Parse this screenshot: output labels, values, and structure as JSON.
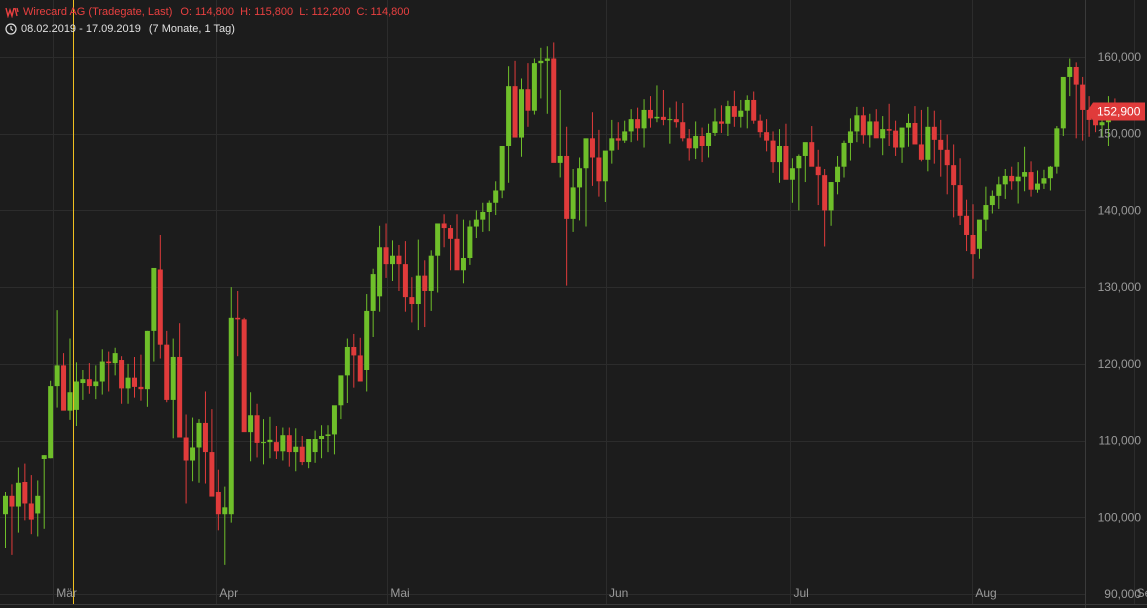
{
  "header": {
    "instrument": "Wirecard AG (Tradegate, Last)",
    "ohlc": "O: 114,800  H: 115,800  L: 112,200  C: 114,800",
    "period": "08.02.2019 - 17.09.2019",
    "range": "(7 Monate, 1 Tag)",
    "logo_icon": "instrument-logo-icon",
    "clock_icon": "clock-icon"
  },
  "last_price": "152,900",
  "colors": {
    "background": "#1c1c1c",
    "grid": "#2c2c2c",
    "up": "#6fbf2a",
    "down": "#e03b3b",
    "cursor": "#f0c020",
    "price_tag": "#e03b3b",
    "axis_text": "#9a9a9a"
  },
  "chart_data": {
    "type": "candlestick",
    "title": "Wirecard AG (Tradegate, Last)",
    "x_labels": [
      "Mär",
      "Apr",
      "Mai",
      "Jun",
      "Jul",
      "Aug",
      "Sep"
    ],
    "x_label_positions": [
      7.4,
      32.7,
      59.2,
      93.1,
      121.7,
      149.9,
      174.9
    ],
    "y_ticks": [
      90000,
      100000,
      110000,
      120000,
      130000,
      140000,
      150000,
      160000
    ],
    "y_tick_labels": [
      "90,000",
      "100,000",
      "110,000",
      "120,000",
      "130,000",
      "140,000",
      "150,000",
      "160,000"
    ],
    "ylim": [
      90000,
      167000
    ],
    "grid": true,
    "crosshair_index": 10.5,
    "candles": [
      [
        100400,
        103300,
        96000,
        102800
      ],
      [
        102800,
        104300,
        95100,
        101400
      ],
      [
        101400,
        106500,
        98000,
        104500
      ],
      [
        104600,
        107000,
        99600,
        101800
      ],
      [
        101800,
        105500,
        97800,
        99700
      ],
      [
        100500,
        104800,
        97500,
        102800
      ],
      [
        107600,
        108100,
        98500,
        108100
      ],
      [
        107700,
        117800,
        107700,
        117100
      ],
      [
        117100,
        127000,
        114300,
        119800
      ],
      [
        119800,
        121400,
        115100,
        113900
      ],
      [
        113900,
        123300,
        112700,
        116300
      ],
      [
        114000,
        120200,
        111900,
        117700
      ],
      [
        117500,
        119200,
        115300,
        118000
      ],
      [
        118000,
        120100,
        116100,
        117100
      ],
      [
        117100,
        119800,
        115400,
        117700
      ],
      [
        117700,
        121900,
        116000,
        120300
      ],
      [
        120300,
        121600,
        116400,
        120100
      ],
      [
        120100,
        122100,
        118500,
        121400
      ],
      [
        120500,
        121000,
        114800,
        116800
      ],
      [
        116800,
        120000,
        114800,
        118200
      ],
      [
        118200,
        120900,
        115600,
        117000
      ],
      [
        117000,
        121200,
        115200,
        116700
      ],
      [
        116700,
        124300,
        114400,
        124300
      ],
      [
        124300,
        131600,
        120300,
        132500
      ],
      [
        132300,
        136800,
        120700,
        122500
      ],
      [
        122500,
        124300,
        115000,
        115300
      ],
      [
        115300,
        123300,
        110300,
        120900
      ],
      [
        120900,
        125300,
        112300,
        110400
      ],
      [
        110400,
        113400,
        101800,
        107400
      ],
      [
        107400,
        113000,
        104700,
        109100
      ],
      [
        109100,
        112800,
        104500,
        112300
      ],
      [
        112300,
        116400,
        104400,
        108500
      ],
      [
        108500,
        114100,
        103100,
        102700
      ],
      [
        103300,
        106200,
        98300,
        100400
      ],
      [
        100400,
        104000,
        93800,
        101300
      ],
      [
        100400,
        130000,
        99300,
        126000
      ],
      [
        126000,
        129500,
        121000,
        125800
      ],
      [
        125800,
        126000,
        115400,
        111100
      ],
      [
        111100,
        116300,
        107300,
        113300
      ],
      [
        113300,
        114800,
        107800,
        109700
      ],
      [
        109700,
        112800,
        106900,
        109800
      ],
      [
        109800,
        113100,
        107700,
        110100
      ],
      [
        109800,
        111900,
        107600,
        108600
      ],
      [
        108600,
        111700,
        107400,
        110700
      ],
      [
        110700,
        111700,
        106600,
        108500
      ],
      [
        108500,
        111600,
        106000,
        109200
      ],
      [
        109200,
        110600,
        106800,
        107200
      ],
      [
        107200,
        109700,
        106400,
        110200
      ],
      [
        108500,
        111300,
        107100,
        110200
      ],
      [
        110200,
        112000,
        107700,
        110600
      ],
      [
        110600,
        112000,
        108500,
        110800
      ],
      [
        110800,
        113900,
        108200,
        114600
      ],
      [
        114600,
        117700,
        112800,
        118500
      ],
      [
        118500,
        123300,
        114900,
        122200
      ],
      [
        122200,
        123900,
        116900,
        121100
      ],
      [
        121100,
        123400,
        117700,
        117700
      ],
      [
        119200,
        129100,
        116400,
        126900
      ],
      [
        126900,
        132400,
        123500,
        131700
      ],
      [
        128800,
        138000,
        126800,
        135200
      ],
      [
        135200,
        138300,
        131200,
        133000
      ],
      [
        133000,
        136100,
        130800,
        134100
      ],
      [
        134100,
        135500,
        129500,
        133000
      ],
      [
        133000,
        136000,
        126800,
        128700
      ],
      [
        128700,
        131300,
        125400,
        127800
      ],
      [
        127800,
        136200,
        124400,
        131500
      ],
      [
        131500,
        133500,
        124800,
        129500
      ],
      [
        129500,
        134800,
        126900,
        134100
      ],
      [
        134100,
        137300,
        129300,
        138300
      ],
      [
        138300,
        139500,
        135200,
        137700
      ],
      [
        137700,
        138100,
        132200,
        136300
      ],
      [
        136300,
        139500,
        132800,
        132200
      ],
      [
        132200,
        138800,
        130500,
        133800
      ],
      [
        133800,
        138700,
        132900,
        137900
      ],
      [
        137900,
        140000,
        136400,
        138800
      ],
      [
        138800,
        141000,
        137200,
        139800
      ],
      [
        139800,
        141300,
        137300,
        141000
      ],
      [
        141000,
        143800,
        139400,
        142600
      ],
      [
        142600,
        146900,
        141600,
        148400
      ],
      [
        148400,
        158800,
        143600,
        156200
      ],
      [
        156200,
        159500,
        150900,
        149500
      ],
      [
        149500,
        157200,
        147000,
        155800
      ],
      [
        155800,
        159200,
        150900,
        153000
      ],
      [
        153000,
        159800,
        152500,
        159200
      ],
      [
        159200,
        161200,
        154600,
        159500
      ],
      [
        159500,
        161400,
        152600,
        159800
      ],
      [
        159800,
        161900,
        146800,
        146200
      ],
      [
        146200,
        155700,
        144300,
        147100
      ],
      [
        147100,
        150900,
        130200,
        138900
      ],
      [
        138900,
        145400,
        137200,
        143000
      ],
      [
        143000,
        146900,
        138700,
        145500
      ],
      [
        145500,
        148000,
        137900,
        149400
      ],
      [
        149400,
        152800,
        143200,
        146900
      ],
      [
        146900,
        150500,
        141800,
        143800
      ],
      [
        143800,
        147200,
        141100,
        147800
      ],
      [
        147800,
        151800,
        146100,
        149400
      ],
      [
        149400,
        151500,
        147900,
        149100
      ],
      [
        149100,
        151700,
        148800,
        150300
      ],
      [
        150300,
        153200,
        148900,
        151900
      ],
      [
        151900,
        153400,
        149100,
        150700
      ],
      [
        150700,
        154500,
        148200,
        153100
      ],
      [
        153100,
        154900,
        150800,
        152000
      ],
      [
        152000,
        156300,
        151500,
        152200
      ],
      [
        152200,
        155700,
        151100,
        151800
      ],
      [
        151800,
        153400,
        148700,
        151900
      ],
      [
        151900,
        154200,
        150800,
        151500
      ],
      [
        151500,
        154000,
        149000,
        149400
      ],
      [
        149400,
        150600,
        146500,
        148100
      ],
      [
        148100,
        151600,
        146700,
        149700
      ],
      [
        149700,
        150800,
        146300,
        148400
      ],
      [
        148400,
        151300,
        146900,
        150100
      ],
      [
        150100,
        153300,
        149700,
        151600
      ],
      [
        151600,
        153700,
        150100,
        151300
      ],
      [
        151300,
        154300,
        149700,
        153600
      ],
      [
        153600,
        155600,
        150900,
        152200
      ],
      [
        152200,
        154400,
        150800,
        153000
      ],
      [
        153000,
        155000,
        150700,
        154400
      ],
      [
        154400,
        155500,
        151300,
        151700
      ],
      [
        151700,
        152500,
        149500,
        150200
      ],
      [
        150200,
        151900,
        147700,
        149100
      ],
      [
        149100,
        150300,
        144900,
        146300
      ],
      [
        146300,
        150600,
        143600,
        148400
      ],
      [
        148400,
        151300,
        145900,
        144000
      ],
      [
        144000,
        146800,
        141000,
        145500
      ],
      [
        145500,
        147300,
        140000,
        147100
      ],
      [
        147100,
        148700,
        143700,
        148900
      ],
      [
        148900,
        151000,
        146600,
        145700
      ],
      [
        145700,
        147900,
        140700,
        144600
      ],
      [
        144600,
        145400,
        135300,
        140000
      ],
      [
        140000,
        143700,
        138000,
        143700
      ],
      [
        143700,
        147100,
        142100,
        145700
      ],
      [
        145700,
        149100,
        144300,
        148800
      ],
      [
        148800,
        152000,
        146500,
        150300
      ],
      [
        150300,
        153500,
        148900,
        152400
      ],
      [
        152400,
        153500,
        148700,
        149800
      ],
      [
        149800,
        152600,
        148200,
        151600
      ],
      [
        151600,
        153200,
        149900,
        149400
      ],
      [
        149400,
        152300,
        147200,
        150600
      ],
      [
        150600,
        153900,
        148400,
        150400
      ],
      [
        150400,
        151700,
        147100,
        148200
      ],
      [
        148200,
        150100,
        146200,
        150800
      ],
      [
        150800,
        152600,
        148300,
        151400
      ],
      [
        151400,
        153600,
        149300,
        148600
      ],
      [
        148600,
        153100,
        146400,
        146600
      ],
      [
        146600,
        153500,
        145100,
        150900
      ],
      [
        150900,
        153000,
        146100,
        149200
      ],
      [
        149200,
        151800,
        144400,
        147900
      ],
      [
        147900,
        149900,
        142100,
        145900
      ],
      [
        145900,
        148600,
        139100,
        143300
      ],
      [
        143300,
        146800,
        138100,
        139300
      ],
      [
        139300,
        141400,
        134700,
        136800
      ],
      [
        136800,
        140800,
        131100,
        134300
      ],
      [
        135000,
        137100,
        133700,
        138800
      ],
      [
        138800,
        143100,
        137300,
        140700
      ],
      [
        140700,
        142600,
        139600,
        141900
      ],
      [
        141900,
        144400,
        140200,
        143400
      ],
      [
        143400,
        145400,
        141500,
        144500
      ],
      [
        144500,
        145700,
        142700,
        143800
      ],
      [
        143800,
        146300,
        140900,
        144400
      ],
      [
        144400,
        148300,
        142500,
        145000
      ],
      [
        145000,
        146400,
        141800,
        142700
      ],
      [
        142700,
        145200,
        142300,
        143500
      ],
      [
        143500,
        145300,
        142800,
        144200
      ],
      [
        144200,
        145800,
        142600,
        145700
      ],
      [
        145700,
        151000,
        144800,
        150700
      ],
      [
        150700,
        156300,
        149700,
        157400
      ],
      [
        157400,
        159800,
        154900,
        158700
      ],
      [
        158700,
        159300,
        149400,
        156400
      ],
      [
        156400,
        157400,
        149100,
        153100
      ],
      [
        153100,
        154900,
        149600,
        151800
      ],
      [
        151800,
        153700,
        150200,
        151100
      ],
      [
        151100,
        153500,
        149600,
        151500
      ],
      [
        151500,
        154900,
        148400,
        153900
      ],
      [
        153900,
        154600,
        152200,
        152900
      ]
    ]
  }
}
